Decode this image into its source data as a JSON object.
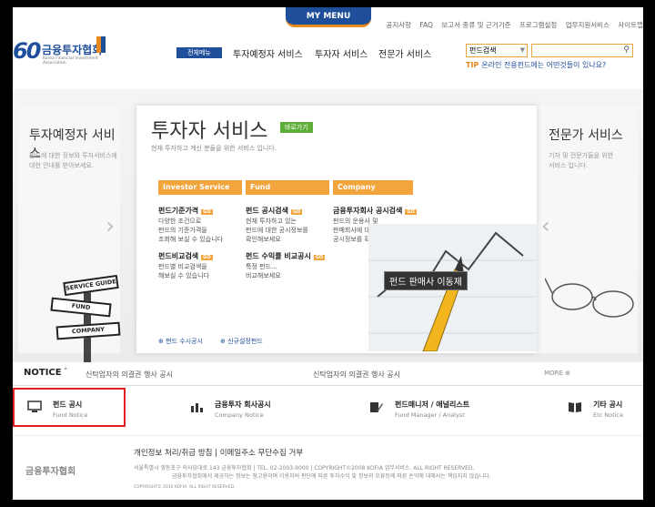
{
  "header": {
    "mymenu": "MY MENU",
    "util_links": [
      "공지사항",
      "FAQ",
      "보고서 종류 및 근거기준",
      "프로그램설정",
      "업무지원서비스",
      "사이트맵"
    ],
    "logo_text": "금융투자협회",
    "logo_sub": "Korea Financial Investment Association",
    "nav_all": "전체메뉴",
    "nav": [
      "투자예정자 서비스",
      "투자자 서비스",
      "전문가 서비스"
    ],
    "search_select": "펀드검색",
    "tip_label": "TIP",
    "tip_text": "온라인 전용펀드에는 어떤것들이 있나요?"
  },
  "hero": {
    "left_title": "투자예정자 서비스",
    "left_desc": [
      "펀드에 대한 정보와 투자서비스에",
      "대한 안내를 받아보세요."
    ],
    "right_title": "전문가 서비스",
    "right_desc": [
      "기자 및 전문가들을 위한",
      "서비스 입니다."
    ],
    "mid_title": "투자자 서비스",
    "mid_badge": "바로가기",
    "mid_desc": "현재 투자하고 계신 분들을 위한 서비스 입니다.",
    "bars": [
      "Investor Service",
      "Fund",
      "Company"
    ],
    "services": [
      {
        "title": "펀드기준가격",
        "desc": [
          "다양한 조건으로",
          "펀드의 기준가격을",
          "조회해 보실 수 있습니다"
        ]
      },
      {
        "title": "펀드 공시검색",
        "desc": [
          "현재 투자하고 있는",
          "펀드에 대한 공시정보를",
          "확인해보세요"
        ]
      },
      {
        "title": "금융투자회사 공시검색",
        "desc": [
          "펀드의 운용사 및",
          "판매회사에 대한",
          "공시정보를 확인해보세요"
        ]
      },
      {
        "title": "펀드비교검색",
        "desc": [
          "펀드별 비교검색을",
          "해보실 수 있습니다"
        ]
      },
      {
        "title": "펀드 수익률 비교공시",
        "desc": [
          "특정 펀드...",
          "비교해보세요"
        ]
      }
    ],
    "links": [
      "펀드 수시공시",
      "신규설정펀드"
    ],
    "tooltip": "펀드 판매사 이동제",
    "signs": [
      "SERVICE GUIDE",
      "FUND",
      "COMPANY"
    ]
  },
  "notice": {
    "label": "NOTICE",
    "items": [
      "신탁업자의 의결권 행사 공시",
      "신탁업자의 의결권 행사 공시"
    ],
    "more": "MORE"
  },
  "quick": [
    {
      "title": "펀드 공시",
      "sub": "Fund Notice",
      "icon": "monitor-icon"
    },
    {
      "title": "금융투자 회사공시",
      "sub": "Company Notice",
      "icon": "bar-chart-icon"
    },
    {
      "title": "펀드매니저 / 애널리스트",
      "sub": "Fund Manager / Analyst",
      "icon": "pen-icon"
    },
    {
      "title": "기타 공시",
      "sub": "Etc Notice",
      "icon": "book-icon"
    }
  ],
  "footer": {
    "logo": "금융투자협회",
    "links": "개인정보 처리/취급 방침 | 이메일주소 무단수집 거부",
    "line1": "서울특별시 영등포구 의사당대로 143 금융투자협회    |    TEL. 02-2003-9000    |    COPYRIGHT©2008 KOFIA 업무서비스. ALL RIGHT RESERVED.",
    "line2": "금융투자협회에서 제공하는 정보는 참고용이며 이용자의 판단에 따른 투자수익 및 정보의 오류등에 따른 손익에 대해서는 책임지지 않습니다.",
    "line3": "COPYRIGHT© 2010 KOFIA. ALL RIGHT RESERVED."
  },
  "colors": {
    "brand_blue": "#1f4f9a",
    "accent_orange": "#f2a53c",
    "highlight_red": "#e02020"
  }
}
